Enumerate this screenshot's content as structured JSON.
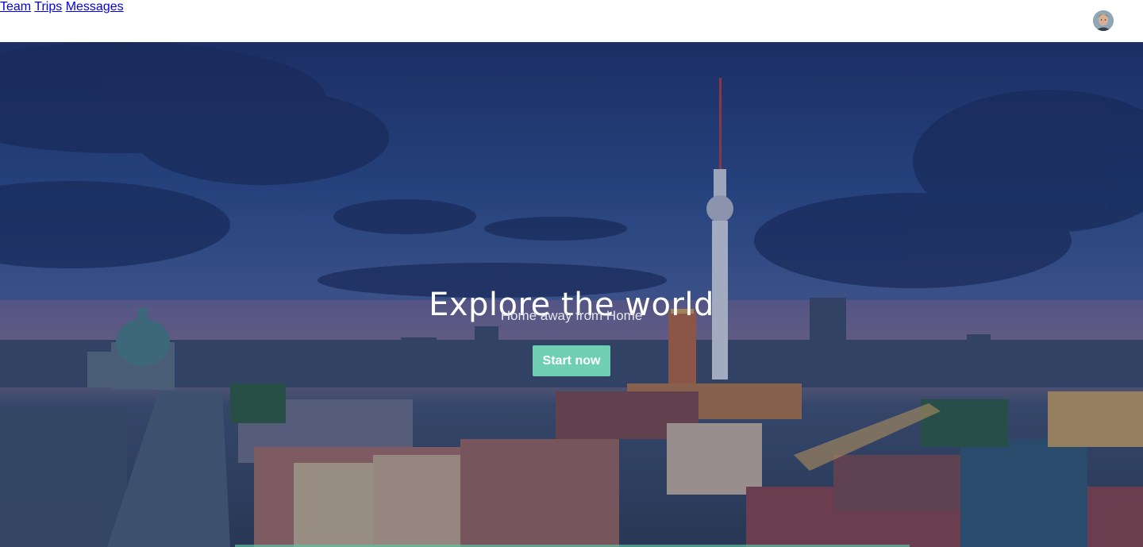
{
  "nav": {
    "items": [
      {
        "label": "Team"
      },
      {
        "label": "Trips"
      },
      {
        "label": "Messages"
      }
    ],
    "avatar_icon": "user-avatar-icon"
  },
  "hero": {
    "title": "Explore the world",
    "subtitle": "Home away from Home",
    "cta_label": "Start now"
  },
  "colors": {
    "accent": "#6fd0b1",
    "overlay": "#1e3a78",
    "nav_text": "#3a3a3a"
  }
}
